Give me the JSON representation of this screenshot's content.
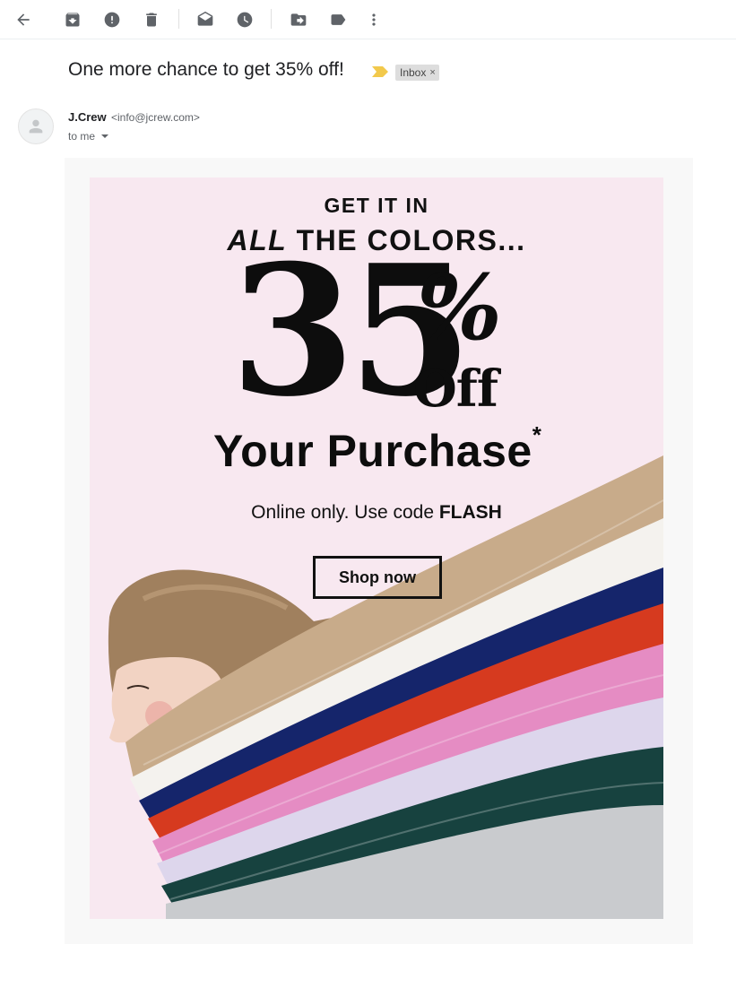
{
  "toolbar": {
    "icons": [
      "back-arrow-icon",
      "archive-icon",
      "report-spam-icon",
      "delete-icon",
      "mark-unread-icon",
      "snooze-icon",
      "move-to-icon",
      "label-icon",
      "more-vert-icon"
    ]
  },
  "email": {
    "subject": "One more chance to get 35% off!",
    "label": "Inbox",
    "label_close": "×",
    "sender_name": "J.Crew",
    "sender_email": "<info@jcrew.com>",
    "recipient": "to me"
  },
  "promo": {
    "line1": "GET IT IN",
    "line2_em": "ALL",
    "line2_rest": " THE COLORS...",
    "big_number": "35",
    "percent": "%",
    "off": "Off",
    "purchase": "Your Purchase",
    "asterisk": "*",
    "online_prefix": "Online only. Use code ",
    "code": "FLASH",
    "cta": "Shop now"
  },
  "colors": {
    "promo_bg": "#f8e8f0",
    "importance": "#f2c94c",
    "sweater_colors": [
      "#c8ab8a",
      "#f4f2ee",
      "#15256b",
      "#d63a1f",
      "#e58cc3",
      "#ddd6ec",
      "#17423f",
      "#c9cbce"
    ]
  }
}
